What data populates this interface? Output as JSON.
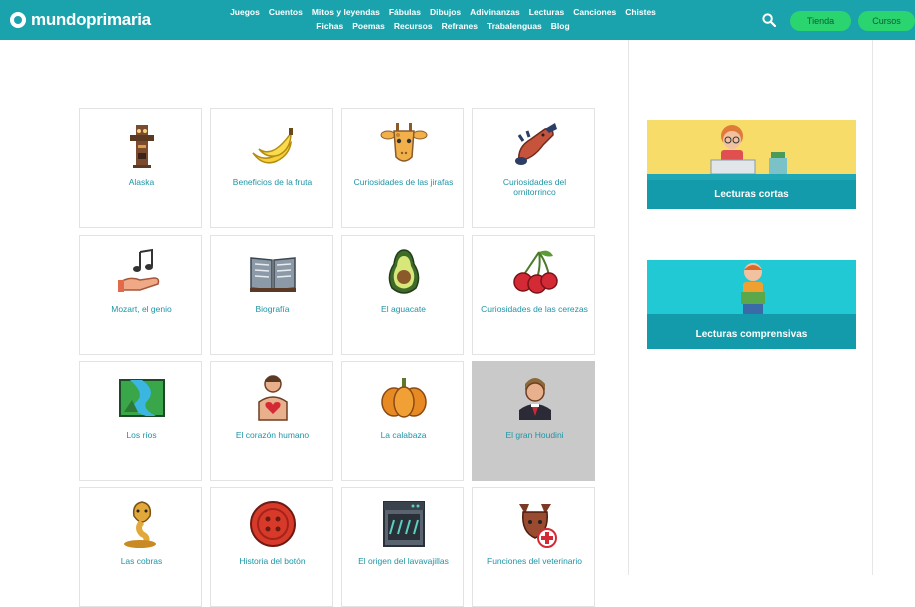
{
  "header": {
    "logo_text": "mundoprimaria",
    "nav_row1": [
      "Juegos",
      "Cuentos",
      "Mitos y leyendas",
      "Fábulas",
      "Dibujos",
      "Adivinanzas",
      "Lecturas",
      "Canciones",
      "Chistes"
    ],
    "nav_row2": [
      "Fichas",
      "Poemas",
      "Recursos",
      "Refranes",
      "Trabalenguas",
      "Blog"
    ],
    "tienda_label": "Tienda",
    "cursos_label": "Cursos",
    "brand_color": "#1aa3ad"
  },
  "grid": {
    "items": [
      {
        "label": "Alaska",
        "icon": "totem-icon"
      },
      {
        "label": "Beneficios de la fruta",
        "icon": "banana-icon"
      },
      {
        "label": "Curiosidades de las jirafas",
        "icon": "giraffe-icon"
      },
      {
        "label": "Curiosidades del ornitorrinco",
        "icon": "platypus-icon"
      },
      {
        "label": "Mozart, el genio",
        "icon": "music-hand-icon"
      },
      {
        "label": "Biografía",
        "icon": "book-icon"
      },
      {
        "label": "El aguacate",
        "icon": "avocado-icon"
      },
      {
        "label": "Curiosidades de las cerezas",
        "icon": "cherries-icon"
      },
      {
        "label": "Los ríos",
        "icon": "river-icon"
      },
      {
        "label": "El corazón humano",
        "icon": "human-heart-icon"
      },
      {
        "label": "La calabaza",
        "icon": "pumpkin-icon"
      },
      {
        "label": "El gran Houdini",
        "icon": "magician-icon"
      },
      {
        "label": "Las cobras",
        "icon": "cobra-icon"
      },
      {
        "label": "Historia del botón",
        "icon": "button-icon"
      },
      {
        "label": "El origen del lavavajillas",
        "icon": "dishwasher-icon"
      },
      {
        "label": "Funciones del veterinario",
        "icon": "vet-icon"
      }
    ],
    "active_index": 11
  },
  "sidebar": {
    "promo1_label": "Lecturas cortas",
    "promo2_label": "Lecturas comprensivas"
  }
}
